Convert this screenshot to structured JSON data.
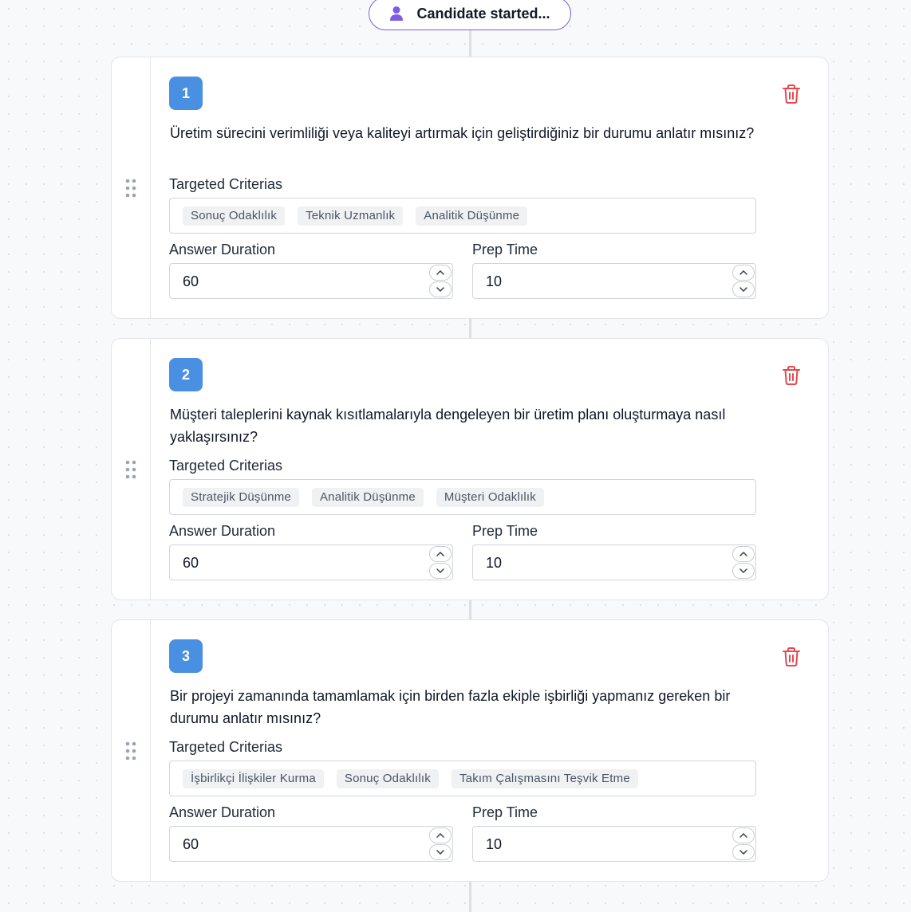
{
  "start_node": {
    "label": "Candidate started...",
    "icon": "user-icon",
    "accent": "#7c5ce6"
  },
  "labels": {
    "criterias": "Targeted Criterias",
    "answer_duration": "Answer Duration",
    "prep_time": "Prep Time"
  },
  "questions": [
    {
      "number": "1",
      "text": "Üretim sürecini verimliliği veya kaliteyi artırmak için geliştirdiğiniz bir durumu anlatır mısınız?",
      "criterias": [
        "Sonuç Odaklılık",
        "Teknik Uzmanlık",
        "Analitik Düşünme"
      ],
      "answer_duration": "60",
      "prep_time": "10"
    },
    {
      "number": "2",
      "text": "Müşteri taleplerini kaynak kısıtlamalarıyla dengeleyen bir üretim planı oluşturmaya nasıl yaklaşırsınız?",
      "criterias": [
        "Stratejik Düşünme",
        "Analitik Düşünme",
        "Müşteri Odaklılık"
      ],
      "answer_duration": "60",
      "prep_time": "10"
    },
    {
      "number": "3",
      "text": "Bir projeyi zamanında tamamlamak için birden fazla ekiple işbirliği yapmanız gereken bir durumu anlatır mısınız?",
      "criterias": [
        "İşbirlikçi İlişkiler Kurma",
        "Sonuç Odaklılık",
        "Takım Çalışmasını Teşvik Etme"
      ],
      "answer_duration": "60",
      "prep_time": "10"
    }
  ],
  "colors": {
    "badge": "#4a90e2",
    "delete": "#e5484d",
    "border": "#e3e5e9"
  }
}
